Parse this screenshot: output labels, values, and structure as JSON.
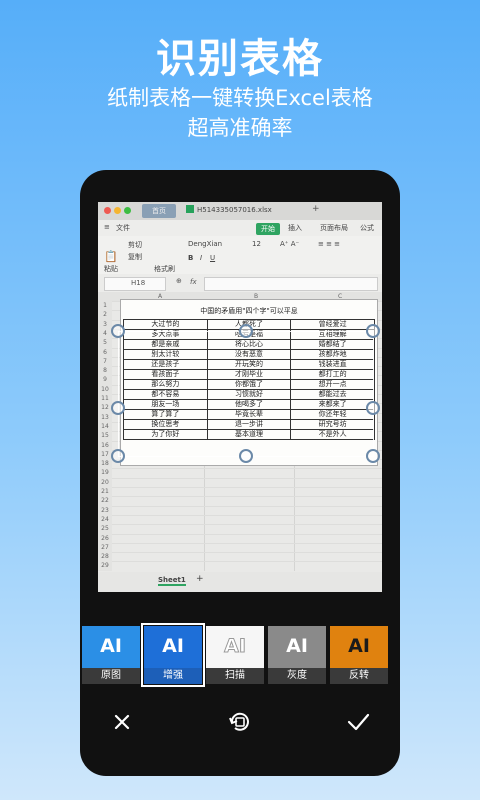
{
  "hero": {
    "title": "识别表格",
    "subtitle_line1": "纸制表格一键转换Excel表格",
    "subtitle_line2": "超高准确率"
  },
  "colors": {
    "background_top": "#56aef9",
    "accent_green": "#2fa461",
    "phone_body": "#111111",
    "selected_filter": "#1e6fd8"
  },
  "spreadsheet": {
    "home_tab": "首页",
    "file_name": "H514335057016.xlsx",
    "menu": [
      "文件",
      "开始",
      "插入",
      "页面布局",
      "公式"
    ],
    "toolbar": {
      "cut": "剪切",
      "copy": "复制",
      "paste": "粘贴",
      "format_painter": "格式刷",
      "font": "DengXian",
      "font_size": "12"
    },
    "cell_ref": "H18",
    "fx": "fx",
    "columns": [
      "A",
      "B",
      "C"
    ],
    "row_numbers": [
      "1",
      "2",
      "3",
      "4",
      "5",
      "6",
      "7",
      "8",
      "9",
      "10",
      "11",
      "12",
      "13",
      "14",
      "15",
      "16",
      "17",
      "18",
      "19",
      "20",
      "21",
      "22",
      "23",
      "24",
      "25",
      "26",
      "27",
      "28",
      "29"
    ],
    "sheet_tab": "Sheet1",
    "sheet_add": "+",
    "table_title": "中国的矛盾用\"四个字\"可以平息",
    "table_rows": [
      [
        "大过节的",
        "人都死了",
        "曾经爱过"
      ],
      [
        "多大点事",
        "吃亏是福",
        "互相理解"
      ],
      [
        "都是亲戚",
        "将心比心",
        "婚都结了"
      ],
      [
        "别太计较",
        "没有恶意",
        "孩都炸地"
      ],
      [
        "还是孩子",
        "开玩笑的",
        "钱装进直"
      ],
      [
        "看孩面子",
        "才刚毕业",
        "都打工的"
      ],
      [
        "那么努力",
        "你都饿了",
        "想开一点"
      ],
      [
        "都不容易",
        "习惯就好",
        "都能过去"
      ],
      [
        "朋友一场",
        "他喝多了",
        "来都来了"
      ],
      [
        "算了算了",
        "毕竟长辈",
        "你还年轻"
      ],
      [
        "换位思考",
        "退一步讲",
        "研究号坊"
      ],
      [
        "为了你好",
        "基本道理",
        "不是外人"
      ]
    ]
  },
  "filters": [
    {
      "label": "原图",
      "badge": "AI"
    },
    {
      "label": "增强",
      "badge": "AI"
    },
    {
      "label": "扫描",
      "badge": "AI"
    },
    {
      "label": "灰度",
      "badge": "AI"
    },
    {
      "label": "反转",
      "badge": "AI"
    }
  ],
  "selected_filter": "增强",
  "actions": {
    "cancel_icon": "close-icon",
    "rotate_icon": "rotate-icon",
    "confirm_icon": "check-icon"
  }
}
